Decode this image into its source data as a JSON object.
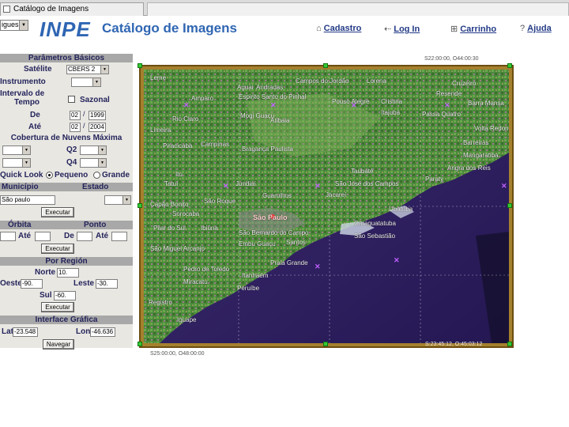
{
  "browser": {
    "tab_title": "Catálogo de Imagens"
  },
  "header": {
    "language_value": "igues",
    "logo": "INPE",
    "title": "Catálogo de Imagens",
    "links": {
      "cadastro": "Cadastro",
      "login": "Log In",
      "carrinho": "Carrinho",
      "ajuda": "Ajuda"
    },
    "icons": {
      "cadastro": "house-icon",
      "login": "arrow-left-icon",
      "carrinho": "cart-icon",
      "ajuda": "question-icon"
    }
  },
  "panel": {
    "basic": {
      "header": "Parâmetros Básicos",
      "satellite_label": "Satélite",
      "satellite_value": "CBERS 2",
      "instrument_label": "Instrumento",
      "interval_label_1": "Intervalo de",
      "interval_label_2": "Tempo",
      "seasonal_label": "Sazonal",
      "from_label": "De",
      "from_day": "02",
      "from_year": "1999",
      "to_label": "Até",
      "to_day": "02",
      "to_year": "2004",
      "date_sep": "/"
    },
    "cloud": {
      "header": "Cobertura de Nuvens Máxima",
      "q2_label": "Q2",
      "q4_label": "Q4"
    },
    "quicklook": {
      "label": "Quick Look",
      "small": "Pequeno",
      "large": "Grande",
      "selected": "Pequeno"
    },
    "location": {
      "municipio_label": "Município",
      "estado_label": "Estado",
      "municipio_value": "São paulo",
      "search_button": "Executar"
    },
    "orbit": {
      "orbita_label": "Órbita",
      "ponto_label": "Ponto",
      "ate_label": "Até",
      "de_label": "De",
      "search_button": "Executar"
    },
    "region": {
      "header": "Por Región",
      "norte_label": "Norte",
      "norte_value": "10.",
      "oeste_label": "Oeste",
      "oeste_value": "-90.",
      "leste_label": "Leste",
      "leste_value": "-30.",
      "sul_label": "Sul",
      "sul_value": "-60.",
      "search_button": "Executar"
    },
    "graphic": {
      "header": "Interface Gráfica",
      "lat_label": "Lat",
      "lat_value": "-23.548",
      "lon_label": "Lon",
      "lon_value": "-46.636",
      "nav_button": "Navegar"
    }
  },
  "map": {
    "coord_top_right": "S22:00:00, O44:00:30",
    "coord_bottom_right": "S:23:45:12, O:45:03:12",
    "coord_bottom_left": "S25:00:00, O48:00:00",
    "places": [
      "Lorena",
      "Aguai",
      "Andradas",
      "Campos do Jordão",
      "Cruzeiro",
      "Resende",
      "Barra Mansa",
      "Espirito Santo do Pinhal",
      "Pouso Alegre",
      "Cristina",
      "Itajubá",
      "Passa Quatro",
      "Leme",
      "Amparo",
      "Mogi Guaçu",
      "Rio Claro",
      "Limeira",
      "Campinas",
      "Atibaia",
      "Bragança Paulista",
      "Piracicaba",
      "Jundiaí",
      "Guarulhos",
      "Taubaté",
      "São José dos Campos",
      "Jacareí",
      "Ubatuba",
      "Caraguatatuba",
      "São Sebastião",
      "São Paulo",
      "Santos",
      "Sorocaba",
      "Itu",
      "Tatuí",
      "São Roque",
      "São Bernardo do Campo",
      "Embu Guaçu",
      "Praia Grande",
      "Itanhaém",
      "Peruíbe",
      "Registro",
      "Iguape",
      "Miracatu",
      "Pedro de Toledo",
      "Pilar do Sul",
      "São Miguel Arcanjo",
      "Capão Bonito",
      "Ibiúna",
      "Angra dos Reis",
      "Paraty",
      "Mangaratiba",
      "Volta Redonda",
      "Barreiras"
    ]
  }
}
